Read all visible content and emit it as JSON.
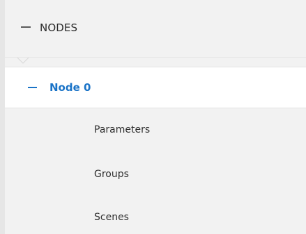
{
  "tree": {
    "header": {
      "label": "NODES",
      "icon": "minus-icon"
    },
    "node": {
      "label": "Node 0",
      "icon": "minus-icon",
      "color": "#1a73c7"
    },
    "children": [
      {
        "label": "Parameters"
      },
      {
        "label": "Groups"
      },
      {
        "label": "Scenes"
      }
    ]
  }
}
